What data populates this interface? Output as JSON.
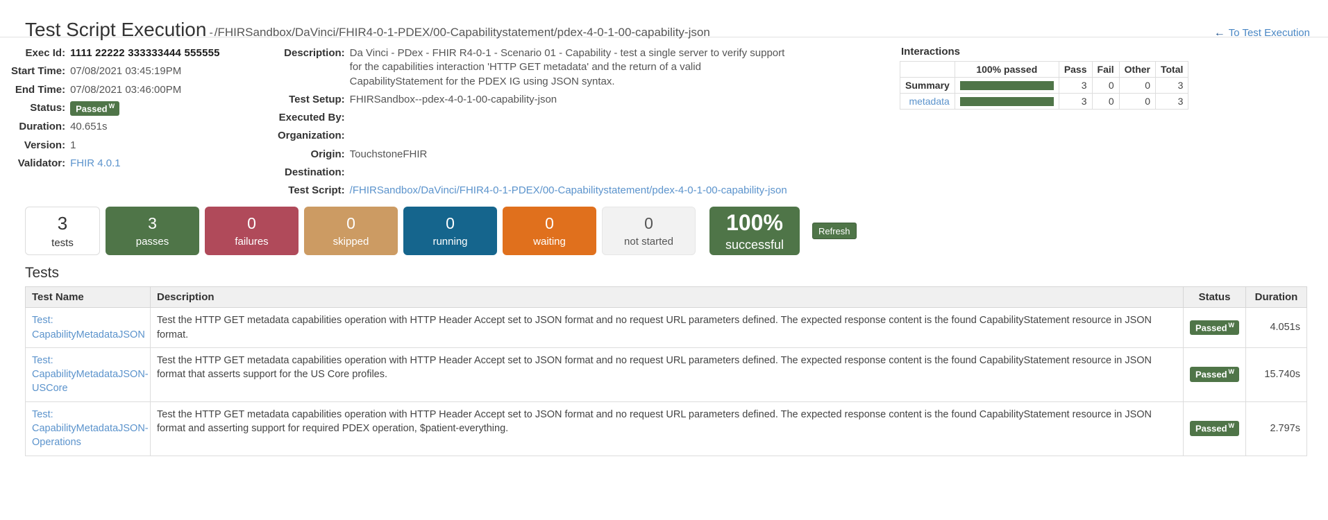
{
  "header": {
    "title": "Test Script Execution",
    "separator": "-",
    "subpath": "/FHIRSandbox/DaVinci/FHIR4-0-1-PDEX/00-Capabilitystatement/pdex-4-0-1-00-capability-json",
    "back_link_label": "To Test Execution",
    "back_arrow_icon": "arrow-left-icon"
  },
  "info_left": {
    "exec_id_label": "Exec Id:",
    "exec_id_value": "1111 22222 333333444 555555",
    "start_time_label": "Start Time:",
    "start_time_value": "07/08/2021 03:45:19PM",
    "end_time_label": "End Time:",
    "end_time_value": "07/08/2021 03:46:00PM",
    "status_label": "Status:",
    "status_value": "Passed",
    "status_superscript": "W",
    "duration_label": "Duration:",
    "duration_value": "40.651s",
    "version_label": "Version:",
    "version_value": "1",
    "validator_label": "Validator:",
    "validator_value": "FHIR 4.0.1"
  },
  "info_mid": {
    "description_label": "Description:",
    "description_value": "Da Vinci - PDex - FHIR R4-0-1 - Scenario 01 - Capability - test a single server to verify support for the capabilities interaction 'HTTP GET metadata' and the return of a valid CapabilityStatement for the PDEX IG using JSON syntax.",
    "test_setup_label": "Test Setup:",
    "test_setup_value": "FHIRSandbox--pdex-4-0-1-00-capability-json",
    "executed_by_label": "Executed By:",
    "executed_by_value": "",
    "organization_label": "Organization:",
    "organization_value": "",
    "origin_label": "Origin:",
    "origin_value": "TouchstoneFHIR",
    "destination_label": "Destination:",
    "destination_value": "",
    "test_script_label": "Test Script:",
    "test_script_value": "/FHIRSandbox/DaVinci/FHIR4-0-1-PDEX/00-Capabilitystatement/pdex-4-0-1-00-capability-json"
  },
  "interactions": {
    "title": "Interactions",
    "columns": [
      "",
      "100% passed",
      "Pass",
      "Fail",
      "Other",
      "Total"
    ],
    "rows": [
      {
        "name": "Summary",
        "is_link": false,
        "percent": 100,
        "pass": "3",
        "fail": "0",
        "other": "0",
        "total": "3"
      },
      {
        "name": "metadata",
        "is_link": true,
        "percent": 100,
        "pass": "3",
        "fail": "0",
        "other": "0",
        "total": "3"
      }
    ]
  },
  "stats": [
    {
      "num": "3",
      "label": "tests",
      "style": "plain"
    },
    {
      "num": "3",
      "label": "passes",
      "style": "passes",
      "color": "#4f7548"
    },
    {
      "num": "0",
      "label": "failures",
      "style": "failures",
      "color": "#b04a5a"
    },
    {
      "num": "0",
      "label": "skipped",
      "style": "skipped",
      "color": "#cc9b63"
    },
    {
      "num": "0",
      "label": "running",
      "style": "running",
      "color": "#15658d"
    },
    {
      "num": "0",
      "label": "waiting",
      "style": "waiting",
      "color": "#e0701d"
    },
    {
      "num": "0",
      "label": "not started",
      "style": "notstarted",
      "color": "#f2f2f2"
    }
  ],
  "percent_box": {
    "num": "100%",
    "label": "successful",
    "color": "#4f7548"
  },
  "refresh_button_label": "Refresh",
  "tests": {
    "heading": "Tests",
    "columns": [
      "Test Name",
      "Description",
      "Status",
      "Duration"
    ],
    "rows": [
      {
        "name_prefix": "Test:",
        "name": "CapabilityMetadataJSON",
        "description": "Test the HTTP GET metadata capabilities operation with HTTP Header Accept set to JSON format and no request URL parameters defined. The expected response content is the found CapabilityStatement resource in JSON format.",
        "status": "Passed",
        "status_superscript": "W",
        "duration": "4.051s"
      },
      {
        "name_prefix": "Test:",
        "name": "CapabilityMetadataJSON-USCore",
        "description": "Test the HTTP GET metadata capabilities operation with HTTP Header Accept set to JSON format and no request URL parameters defined. The expected response content is the found CapabilityStatement resource in JSON format that asserts support for the US Core profiles.",
        "status": "Passed",
        "status_superscript": "W",
        "duration": "15.740s"
      },
      {
        "name_prefix": "Test:",
        "name": "CapabilityMetadataJSON-Operations",
        "description": "Test the HTTP GET metadata capabilities operation with HTTP Header Accept set to JSON format and no request URL parameters defined. The expected response content is the found CapabilityStatement resource in JSON format and asserting support for required PDEX operation, $patient-everything.",
        "status": "Passed",
        "status_superscript": "W",
        "duration": "2.797s"
      }
    ]
  }
}
